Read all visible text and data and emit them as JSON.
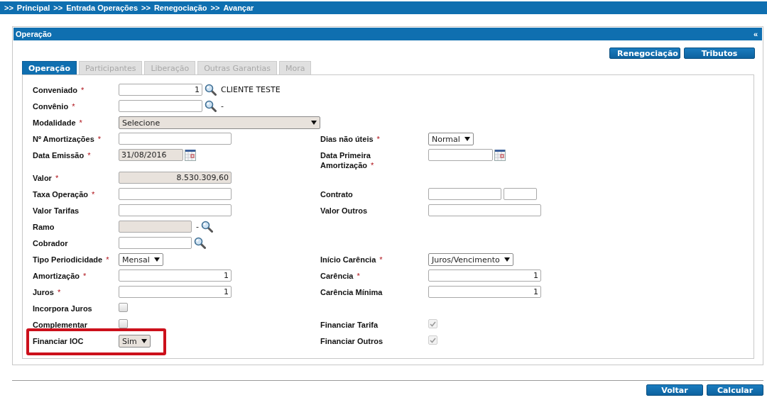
{
  "breadcrumb": {
    "separator": ">>",
    "items": [
      "Principal",
      "Entrada Operações",
      "Renegociação",
      "Avançar"
    ]
  },
  "panel": {
    "title": "Operação",
    "collapse": "«",
    "actions": [
      "Renegociação",
      "Tributos"
    ],
    "tabs": [
      {
        "label": "Operação",
        "selected": true
      },
      {
        "label": "Participantes",
        "selected": false
      },
      {
        "label": "Liberação",
        "selected": false
      },
      {
        "label": "Outras Garantias",
        "selected": false
      },
      {
        "label": "Mora",
        "selected": false
      }
    ],
    "required_mark": "*",
    "rows": [
      {
        "left": {
          "label": "Conveniado",
          "required": true,
          "controls": [
            {
              "kind": "code-input",
              "value": "1"
            },
            {
              "kind": "search"
            },
            {
              "kind": "note",
              "text": "CLIENTE TESTE"
            }
          ]
        }
      },
      {
        "left": {
          "label": "Convênio",
          "required": true,
          "controls": [
            {
              "kind": "code-input"
            },
            {
              "kind": "search"
            },
            {
              "kind": "note",
              "text": "-"
            }
          ]
        }
      },
      {
        "left": {
          "label": "Modalidade",
          "required": true,
          "controls": [
            {
              "kind": "wide-select",
              "value": "Selecione",
              "readonly": true
            }
          ]
        }
      },
      {
        "left": {
          "label": "Nº Amortizações",
          "required": true,
          "controls": [
            {
              "kind": "input"
            }
          ]
        },
        "right": {
          "label": "Dias não úteis",
          "required": true,
          "controls": [
            {
              "kind": "select",
              "value": "Normal"
            }
          ]
        }
      },
      {
        "left": {
          "label": "Data Emissão",
          "required": true,
          "controls": [
            {
              "kind": "date-input",
              "value": "31/08/2016",
              "readonly": true
            },
            {
              "kind": "calendar"
            }
          ]
        },
        "right": {
          "label": "Data Primeira Amortização",
          "required": true,
          "controls": [
            {
              "kind": "date-input"
            },
            {
              "kind": "calendar"
            }
          ]
        }
      },
      {
        "left": {
          "label": "Valor",
          "required": true,
          "controls": [
            {
              "kind": "number-input",
              "value": "8.530.309,60",
              "readonly": true
            }
          ]
        }
      },
      {
        "left": {
          "label": "Taxa Operação",
          "required": true,
          "controls": [
            {
              "kind": "input"
            }
          ]
        },
        "right": {
          "label": "Contrato",
          "required": false,
          "controls": [
            {
              "kind": "short-input"
            },
            {
              "kind": "tiny-input"
            }
          ]
        }
      },
      {
        "left": {
          "label": "Valor Tarifas",
          "required": false,
          "controls": [
            {
              "kind": "input"
            }
          ]
        },
        "right": {
          "label": "Valor Outros",
          "required": false,
          "controls": [
            {
              "kind": "input"
            }
          ]
        }
      },
      {
        "left": {
          "label": "Ramo",
          "required": false,
          "controls": [
            {
              "kind": "short-input",
              "readonly": true
            },
            {
              "kind": "note",
              "text": "-"
            },
            {
              "kind": "search"
            }
          ]
        }
      },
      {
        "left": {
          "label": "Cobrador",
          "required": false,
          "controls": [
            {
              "kind": "short-input"
            },
            {
              "kind": "search"
            }
          ]
        }
      },
      {
        "left": {
          "label": "Tipo Periodicidade",
          "required": true,
          "controls": [
            {
              "kind": "select",
              "value": "Mensal"
            }
          ]
        },
        "right": {
          "label": "Início Carência",
          "required": true,
          "controls": [
            {
              "kind": "select",
              "value": "Juros/Vencimento"
            }
          ]
        }
      },
      {
        "left": {
          "label": "Amortização",
          "required": true,
          "controls": [
            {
              "kind": "number-input",
              "value": "1"
            }
          ]
        },
        "right": {
          "label": "Carência",
          "required": true,
          "controls": [
            {
              "kind": "number-input",
              "value": "1"
            }
          ]
        }
      },
      {
        "left": {
          "label": "Juros",
          "required": true,
          "controls": [
            {
              "kind": "number-input",
              "value": "1"
            }
          ]
        },
        "right": {
          "label": "Carência Mínima",
          "required": false,
          "controls": [
            {
              "kind": "number-input",
              "value": "1"
            }
          ]
        }
      },
      {
        "left": {
          "label": "Incorpora Juros",
          "required": false,
          "controls": [
            {
              "kind": "checkbox",
              "checked": false,
              "disabled": false
            }
          ]
        }
      },
      {
        "left": {
          "label": "Complementar",
          "required": false,
          "controls": [
            {
              "kind": "checkbox",
              "checked": false,
              "disabled": false
            }
          ]
        },
        "right": {
          "label": "Financiar Tarifa",
          "required": false,
          "controls": [
            {
              "kind": "checkbox",
              "checked": true,
              "disabled": true
            }
          ]
        }
      },
      {
        "left": {
          "label": "Financiar IOC",
          "required": false,
          "highlighted": true,
          "controls": [
            {
              "kind": "select",
              "value": "Sim",
              "readonly": true
            }
          ]
        },
        "right": {
          "label": "Financiar Outros",
          "required": false,
          "controls": [
            {
              "kind": "checkbox",
              "checked": true,
              "disabled": true
            }
          ]
        }
      }
    ]
  },
  "footer_buttons": [
    "Voltar",
    "Calcular"
  ]
}
